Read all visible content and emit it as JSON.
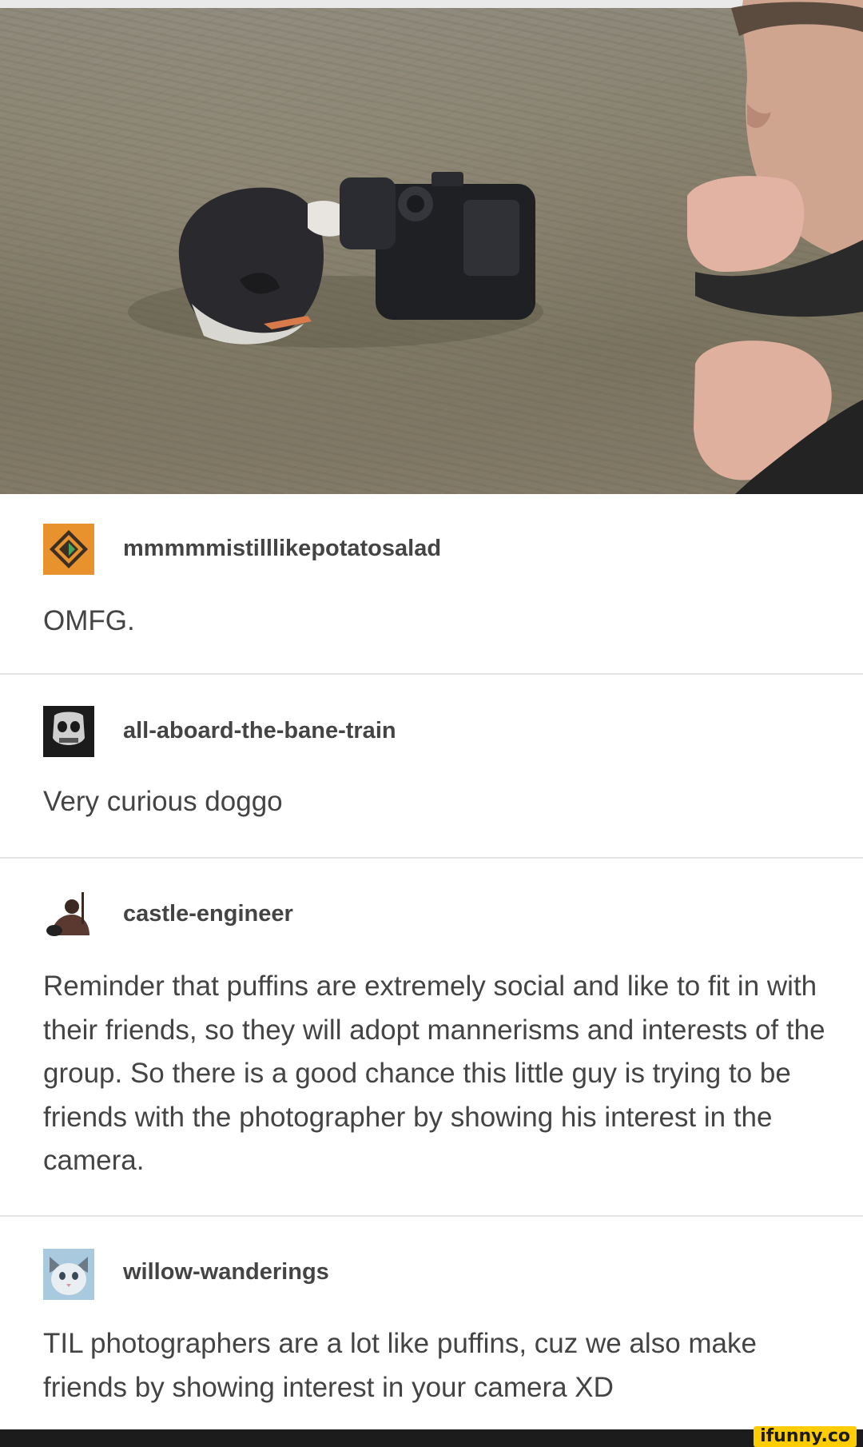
{
  "posts": [
    {
      "username": "mmmmmistilllikepotatosalad",
      "text": "OMFG."
    },
    {
      "username": "all-aboard-the-bane-train",
      "text": "Very curious doggo"
    },
    {
      "username": "castle-engineer",
      "text": "Reminder that puffins are extremely social and like to fit in with their friends, so they will adopt mannerisms and interests of the group. So there is a good chance this little guy is trying to be friends with the photographer by showing his interest in the camera."
    },
    {
      "username": "willow-wanderings",
      "text": "TIL photographers are a lot like puffins, cuz we also make friends by showing interest in your camera XD"
    }
  ],
  "watermark": "ifunny.co",
  "colors": {
    "post_text": "#444444",
    "divider": "#e3e3e3",
    "watermark_bg": "#ffcc00"
  }
}
